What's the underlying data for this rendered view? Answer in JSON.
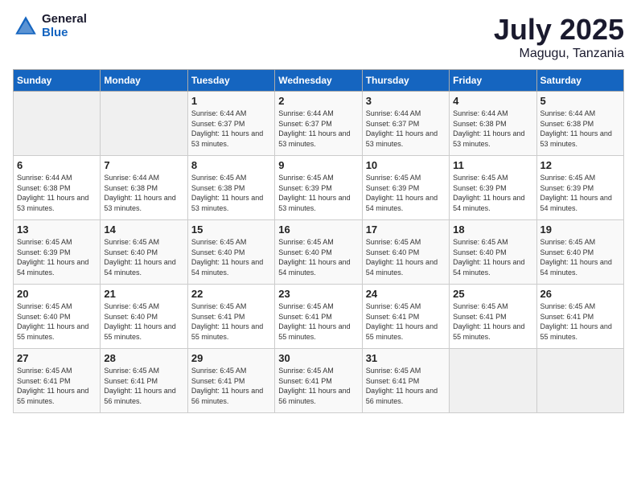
{
  "header": {
    "logo_general": "General",
    "logo_blue": "Blue",
    "month_year": "July 2025",
    "location": "Magugu, Tanzania"
  },
  "days_of_week": [
    "Sunday",
    "Monday",
    "Tuesday",
    "Wednesday",
    "Thursday",
    "Friday",
    "Saturday"
  ],
  "weeks": [
    [
      {
        "day": "",
        "empty": true
      },
      {
        "day": "",
        "empty": true
      },
      {
        "day": "1",
        "sunrise": "6:44 AM",
        "sunset": "6:37 PM",
        "daylight": "11 hours and 53 minutes."
      },
      {
        "day": "2",
        "sunrise": "6:44 AM",
        "sunset": "6:37 PM",
        "daylight": "11 hours and 53 minutes."
      },
      {
        "day": "3",
        "sunrise": "6:44 AM",
        "sunset": "6:37 PM",
        "daylight": "11 hours and 53 minutes."
      },
      {
        "day": "4",
        "sunrise": "6:44 AM",
        "sunset": "6:38 PM",
        "daylight": "11 hours and 53 minutes."
      },
      {
        "day": "5",
        "sunrise": "6:44 AM",
        "sunset": "6:38 PM",
        "daylight": "11 hours and 53 minutes."
      }
    ],
    [
      {
        "day": "6",
        "sunrise": "6:44 AM",
        "sunset": "6:38 PM",
        "daylight": "11 hours and 53 minutes."
      },
      {
        "day": "7",
        "sunrise": "6:44 AM",
        "sunset": "6:38 PM",
        "daylight": "11 hours and 53 minutes."
      },
      {
        "day": "8",
        "sunrise": "6:45 AM",
        "sunset": "6:38 PM",
        "daylight": "11 hours and 53 minutes."
      },
      {
        "day": "9",
        "sunrise": "6:45 AM",
        "sunset": "6:39 PM",
        "daylight": "11 hours and 53 minutes."
      },
      {
        "day": "10",
        "sunrise": "6:45 AM",
        "sunset": "6:39 PM",
        "daylight": "11 hours and 54 minutes."
      },
      {
        "day": "11",
        "sunrise": "6:45 AM",
        "sunset": "6:39 PM",
        "daylight": "11 hours and 54 minutes."
      },
      {
        "day": "12",
        "sunrise": "6:45 AM",
        "sunset": "6:39 PM",
        "daylight": "11 hours and 54 minutes."
      }
    ],
    [
      {
        "day": "13",
        "sunrise": "6:45 AM",
        "sunset": "6:39 PM",
        "daylight": "11 hours and 54 minutes."
      },
      {
        "day": "14",
        "sunrise": "6:45 AM",
        "sunset": "6:40 PM",
        "daylight": "11 hours and 54 minutes."
      },
      {
        "day": "15",
        "sunrise": "6:45 AM",
        "sunset": "6:40 PM",
        "daylight": "11 hours and 54 minutes."
      },
      {
        "day": "16",
        "sunrise": "6:45 AM",
        "sunset": "6:40 PM",
        "daylight": "11 hours and 54 minutes."
      },
      {
        "day": "17",
        "sunrise": "6:45 AM",
        "sunset": "6:40 PM",
        "daylight": "11 hours and 54 minutes."
      },
      {
        "day": "18",
        "sunrise": "6:45 AM",
        "sunset": "6:40 PM",
        "daylight": "11 hours and 54 minutes."
      },
      {
        "day": "19",
        "sunrise": "6:45 AM",
        "sunset": "6:40 PM",
        "daylight": "11 hours and 54 minutes."
      }
    ],
    [
      {
        "day": "20",
        "sunrise": "6:45 AM",
        "sunset": "6:40 PM",
        "daylight": "11 hours and 55 minutes."
      },
      {
        "day": "21",
        "sunrise": "6:45 AM",
        "sunset": "6:40 PM",
        "daylight": "11 hours and 55 minutes."
      },
      {
        "day": "22",
        "sunrise": "6:45 AM",
        "sunset": "6:41 PM",
        "daylight": "11 hours and 55 minutes."
      },
      {
        "day": "23",
        "sunrise": "6:45 AM",
        "sunset": "6:41 PM",
        "daylight": "11 hours and 55 minutes."
      },
      {
        "day": "24",
        "sunrise": "6:45 AM",
        "sunset": "6:41 PM",
        "daylight": "11 hours and 55 minutes."
      },
      {
        "day": "25",
        "sunrise": "6:45 AM",
        "sunset": "6:41 PM",
        "daylight": "11 hours and 55 minutes."
      },
      {
        "day": "26",
        "sunrise": "6:45 AM",
        "sunset": "6:41 PM",
        "daylight": "11 hours and 55 minutes."
      }
    ],
    [
      {
        "day": "27",
        "sunrise": "6:45 AM",
        "sunset": "6:41 PM",
        "daylight": "11 hours and 55 minutes."
      },
      {
        "day": "28",
        "sunrise": "6:45 AM",
        "sunset": "6:41 PM",
        "daylight": "11 hours and 56 minutes."
      },
      {
        "day": "29",
        "sunrise": "6:45 AM",
        "sunset": "6:41 PM",
        "daylight": "11 hours and 56 minutes."
      },
      {
        "day": "30",
        "sunrise": "6:45 AM",
        "sunset": "6:41 PM",
        "daylight": "11 hours and 56 minutes."
      },
      {
        "day": "31",
        "sunrise": "6:45 AM",
        "sunset": "6:41 PM",
        "daylight": "11 hours and 56 minutes."
      },
      {
        "day": "",
        "empty": true
      },
      {
        "day": "",
        "empty": true
      }
    ]
  ],
  "labels": {
    "sunrise": "Sunrise:",
    "sunset": "Sunset:",
    "daylight": "Daylight:"
  }
}
